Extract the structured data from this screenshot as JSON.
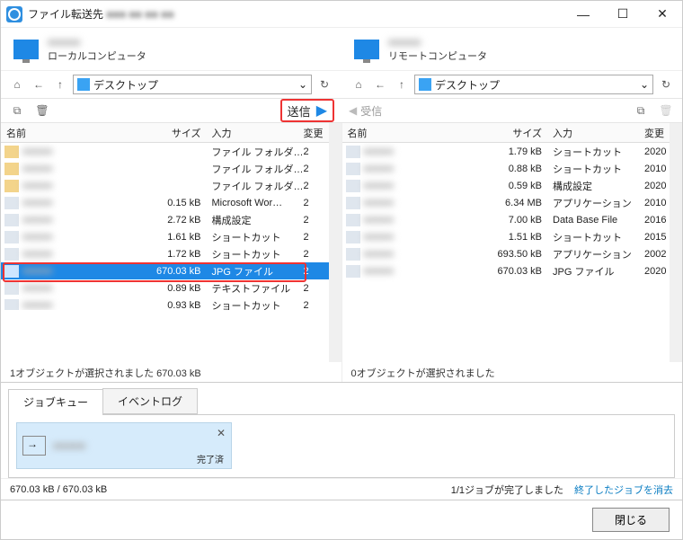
{
  "title": "ファイル転送先",
  "win": {
    "min": "—",
    "max": "☐",
    "close": "✕"
  },
  "computers": {
    "local": {
      "name": "■■■■■",
      "sub": "ローカルコンピュータ"
    },
    "remote": {
      "name": "■■■■■",
      "sub": "リモートコンピュータ"
    }
  },
  "nav": {
    "home": "⌂",
    "back": "←",
    "up": "↑",
    "path": "デスクトップ",
    "refresh": "↻"
  },
  "actions": {
    "newfolder": "⧉",
    "delete": "🗑",
    "send": "送信",
    "receive": "受信"
  },
  "columns": {
    "name": "名前",
    "size": "サイズ",
    "type": "入力",
    "date": "変更"
  },
  "left": {
    "rows": [
      {
        "name": "■■■■■",
        "size": "",
        "type": "ファイル フォルダ…",
        "date": "2"
      },
      {
        "name": "■■■■■",
        "size": "",
        "type": "ファイル フォルダ…",
        "date": "2"
      },
      {
        "name": "■■■■■",
        "size": "",
        "type": "ファイル フォルダ…",
        "date": "2"
      },
      {
        "name": "■■■■■",
        "size": "0.15 kB",
        "type": "Microsoft Wor…",
        "date": "2"
      },
      {
        "name": "■■■■■",
        "size": "2.72 kB",
        "type": "構成設定",
        "date": "2"
      },
      {
        "name": "■■■■■",
        "size": "1.61 kB",
        "type": "ショートカット",
        "date": "2"
      },
      {
        "name": "■■■■■",
        "size": "1.72 kB",
        "type": "ショートカット",
        "date": "2"
      },
      {
        "name": "■■■■■",
        "size": "670.03 kB",
        "type": "JPG ファイル",
        "date": "2",
        "selected": true
      },
      {
        "name": "■■■■■",
        "size": "0.89 kB",
        "type": "テキストファイル",
        "date": "2"
      },
      {
        "name": "■■■■■",
        "size": "0.93 kB",
        "type": "ショートカット",
        "date": "2"
      }
    ],
    "status": "1オブジェクトが選択されました  670.03 kB"
  },
  "right": {
    "rows": [
      {
        "name": "■■■■■",
        "size": "1.79 kB",
        "type": "ショートカット",
        "date": "2020"
      },
      {
        "name": "■■■■■",
        "size": "0.88 kB",
        "type": "ショートカット",
        "date": "2010"
      },
      {
        "name": "■■■■■",
        "size": "0.59 kB",
        "type": "構成設定",
        "date": "2020"
      },
      {
        "name": "■■■■■",
        "size": "6.34 MB",
        "type": "アプリケーション",
        "date": "2010"
      },
      {
        "name": "■■■■■",
        "size": "7.00 kB",
        "type": "Data Base File",
        "date": "2016"
      },
      {
        "name": "■■■■■",
        "size": "1.51 kB",
        "type": "ショートカット",
        "date": "2015"
      },
      {
        "name": "■■■■■",
        "size": "693.50 kB",
        "type": "アプリケーション",
        "date": "2002"
      },
      {
        "name": "■■■■■",
        "size": "670.03 kB",
        "type": "JPG ファイル",
        "date": "2020"
      }
    ],
    "status": "0オブジェクトが選択されました"
  },
  "tabs": {
    "queue": "ジョブキュー",
    "log": "イベントログ"
  },
  "job": {
    "name": "■■■■■",
    "status": "完了済",
    "close": "✕"
  },
  "bottom": {
    "size": "670.03 kB / 670.03 kB",
    "progress": "1/1ジョブが完了しました",
    "clear": "終了したジョブを消去"
  },
  "footer": {
    "close": "閉じる"
  }
}
